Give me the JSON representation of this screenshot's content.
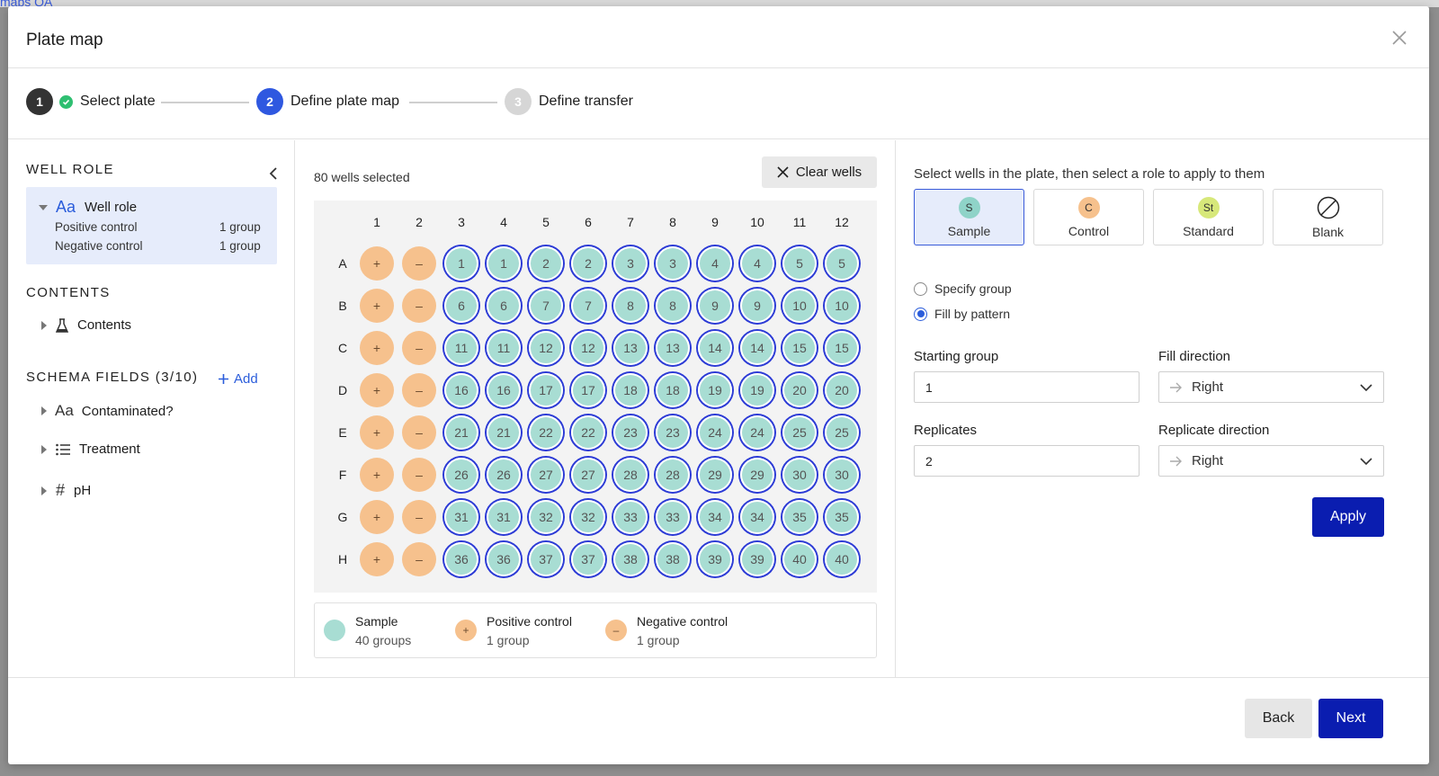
{
  "background": {
    "tab_label": "maps QA"
  },
  "modal": {
    "title": "Plate map"
  },
  "stepper": {
    "steps": [
      {
        "num": "1",
        "label": "Select plate",
        "state": "complete"
      },
      {
        "num": "2",
        "label": "Define plate map",
        "state": "active"
      },
      {
        "num": "3",
        "label": "Define transfer",
        "state": "pending"
      }
    ]
  },
  "left": {
    "well_role_title": "WELL ROLE",
    "well_role_node": {
      "type_glyph": "Aa",
      "label": "Well role"
    },
    "well_role_items": [
      {
        "label": "Positive control",
        "count": "1 group"
      },
      {
        "label": "Negative control",
        "count": "1 group"
      }
    ],
    "contents_title": "CONTENTS",
    "contents_item": "Contents",
    "schema_title": "SCHEMA FIELDS (3/10)",
    "add_label": "Add",
    "schema_fields": [
      {
        "glyph": "Aa",
        "label": "Contaminated?"
      },
      {
        "glyph": "list",
        "label": "Treatment"
      },
      {
        "glyph": "#",
        "label": "pH"
      }
    ]
  },
  "center": {
    "wells_selected": "80 wells selected",
    "clear_label": "Clear wells",
    "columns": [
      "1",
      "2",
      "3",
      "4",
      "5",
      "6",
      "7",
      "8",
      "9",
      "10",
      "11",
      "12"
    ],
    "rows": [
      "A",
      "B",
      "C",
      "D",
      "E",
      "F",
      "G",
      "H"
    ],
    "positive_symbol": "+",
    "negative_symbol": "–",
    "legend": [
      {
        "name": "Sample",
        "count": "40 groups",
        "symbol": ""
      },
      {
        "name": "Positive control",
        "count": "1 group",
        "symbol": "+"
      },
      {
        "name": "Negative control",
        "count": "1 group",
        "symbol": "–"
      }
    ]
  },
  "right": {
    "instructions": "Select wells in the plate, then select a role to apply to them",
    "roles": [
      {
        "chip": "S",
        "label": "Sample",
        "color": "#8fd3c8",
        "active": true
      },
      {
        "chip": "C",
        "label": "Control",
        "color": "#f6c18d",
        "active": false
      },
      {
        "chip": "St",
        "label": "Standard",
        "color": "#d7e87a",
        "active": false
      },
      {
        "chip": "",
        "label": "Blank",
        "color": "#ffffff",
        "active": false
      }
    ],
    "radio_specify": "Specify group",
    "radio_fill": "Fill by pattern",
    "starting_group_label": "Starting group",
    "starting_group_value": "1",
    "fill_direction_label": "Fill direction",
    "fill_direction_value": "Right",
    "replicates_label": "Replicates",
    "replicates_value": "2",
    "replicate_direction_label": "Replicate direction",
    "replicate_direction_value": "Right",
    "apply_label": "Apply"
  },
  "footer": {
    "back_label": "Back",
    "next_label": "Next"
  },
  "colors": {
    "primary": "#0a1db0",
    "accent": "#2b5ddb",
    "sample": "#a8ddd3",
    "control": "#f6c18d",
    "selected_ring": "#2c3ad6"
  }
}
